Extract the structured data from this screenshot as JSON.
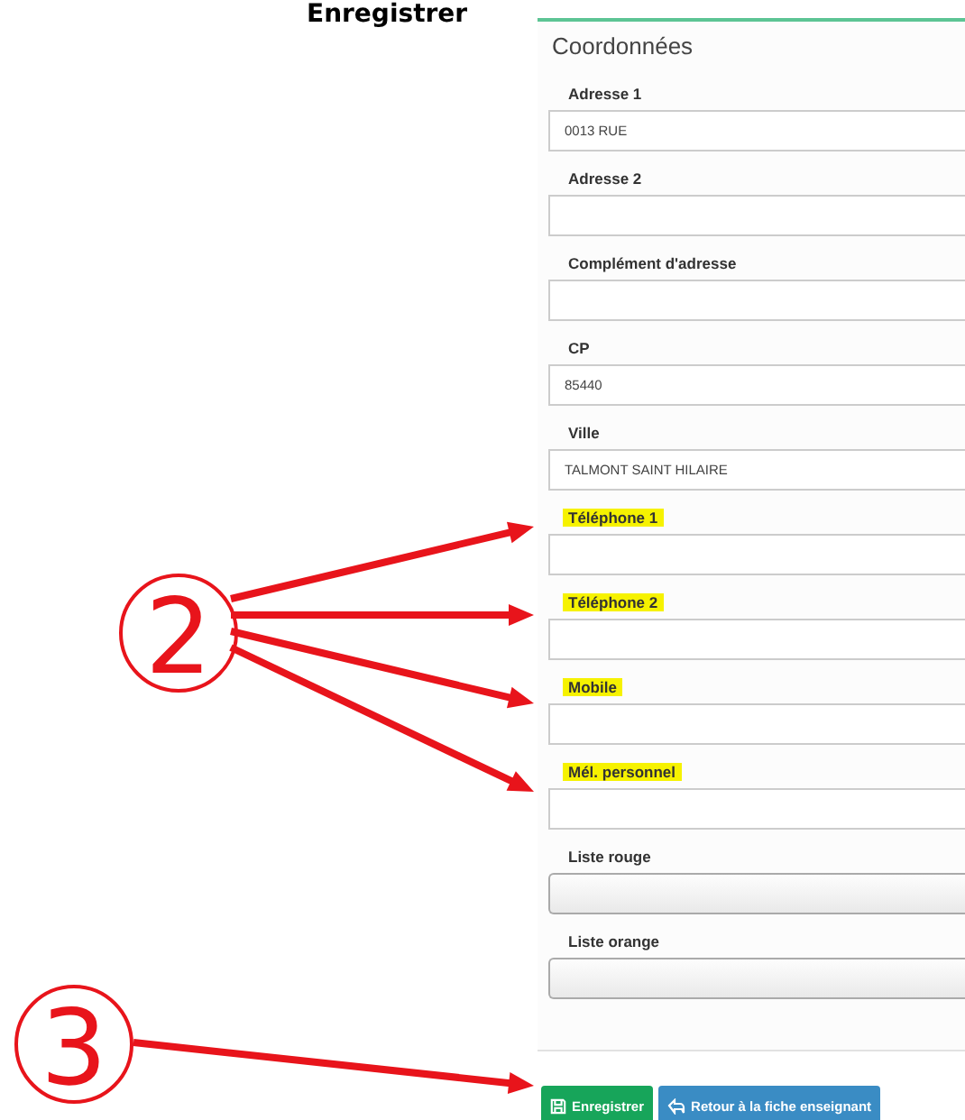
{
  "heading": "Enregistrer",
  "panel": {
    "title": "Coordonnées",
    "fields": [
      {
        "label": "Adresse 1",
        "kind": "text",
        "value": "0013 RUE",
        "highlighted": false
      },
      {
        "label": "Adresse 2",
        "kind": "text",
        "highlighted": false
      },
      {
        "label": "Complément d'adresse",
        "kind": "text",
        "highlighted": false
      },
      {
        "label": "CP",
        "kind": "text",
        "value": "85440",
        "highlighted": false
      },
      {
        "label": "Ville",
        "kind": "text",
        "value": "TALMONT SAINT HILAIRE",
        "highlighted": false
      },
      {
        "label": "Téléphone 1",
        "kind": "text",
        "highlighted": true
      },
      {
        "label": "Téléphone 2",
        "kind": "text",
        "highlighted": true
      },
      {
        "label": "Mobile",
        "kind": "text",
        "highlighted": true
      },
      {
        "label": "Mél. personnel",
        "kind": "text",
        "highlighted": true
      },
      {
        "label": "Liste rouge",
        "kind": "select",
        "highlighted": false
      },
      {
        "label": "Liste orange",
        "kind": "select",
        "highlighted": false
      }
    ],
    "buttons": [
      {
        "label": "Enregistrer",
        "kind": "save"
      },
      {
        "label": "Retour à la fiche enseignant",
        "kind": "back"
      }
    ]
  },
  "annotations": [
    {
      "label": "2"
    },
    {
      "label": "3"
    }
  ]
}
